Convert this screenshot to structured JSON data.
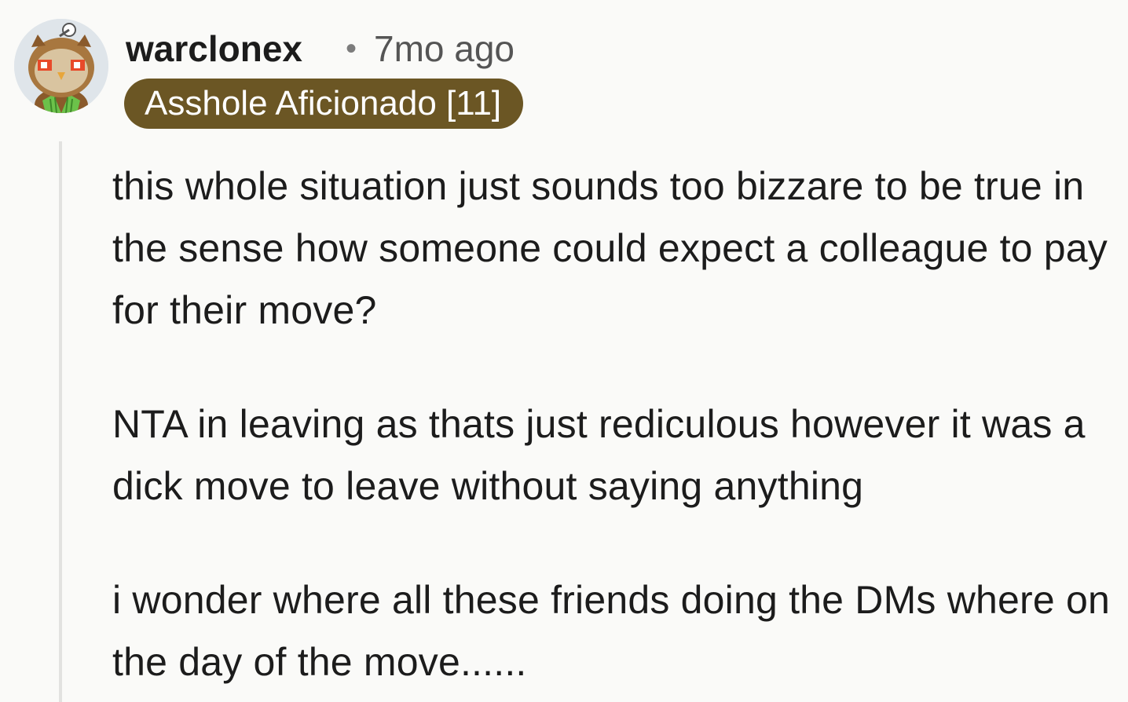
{
  "comment": {
    "author": "warclonex",
    "separator": "•",
    "timestamp": "7mo ago",
    "flair": "Asshole Aficionado [11]",
    "avatar_icon": "owl-avatar-icon",
    "flair_color": "#6b5624",
    "paragraphs": [
      "this whole situation just sounds too bizzare to be true in the sense how someone could expect a colleague to pay for their move?",
      "NTA in leaving as thats just rediculous however it was a dick move to leave without saying anything",
      "i wonder where all these friends doing the DMs where on the day of the move......"
    ]
  }
}
